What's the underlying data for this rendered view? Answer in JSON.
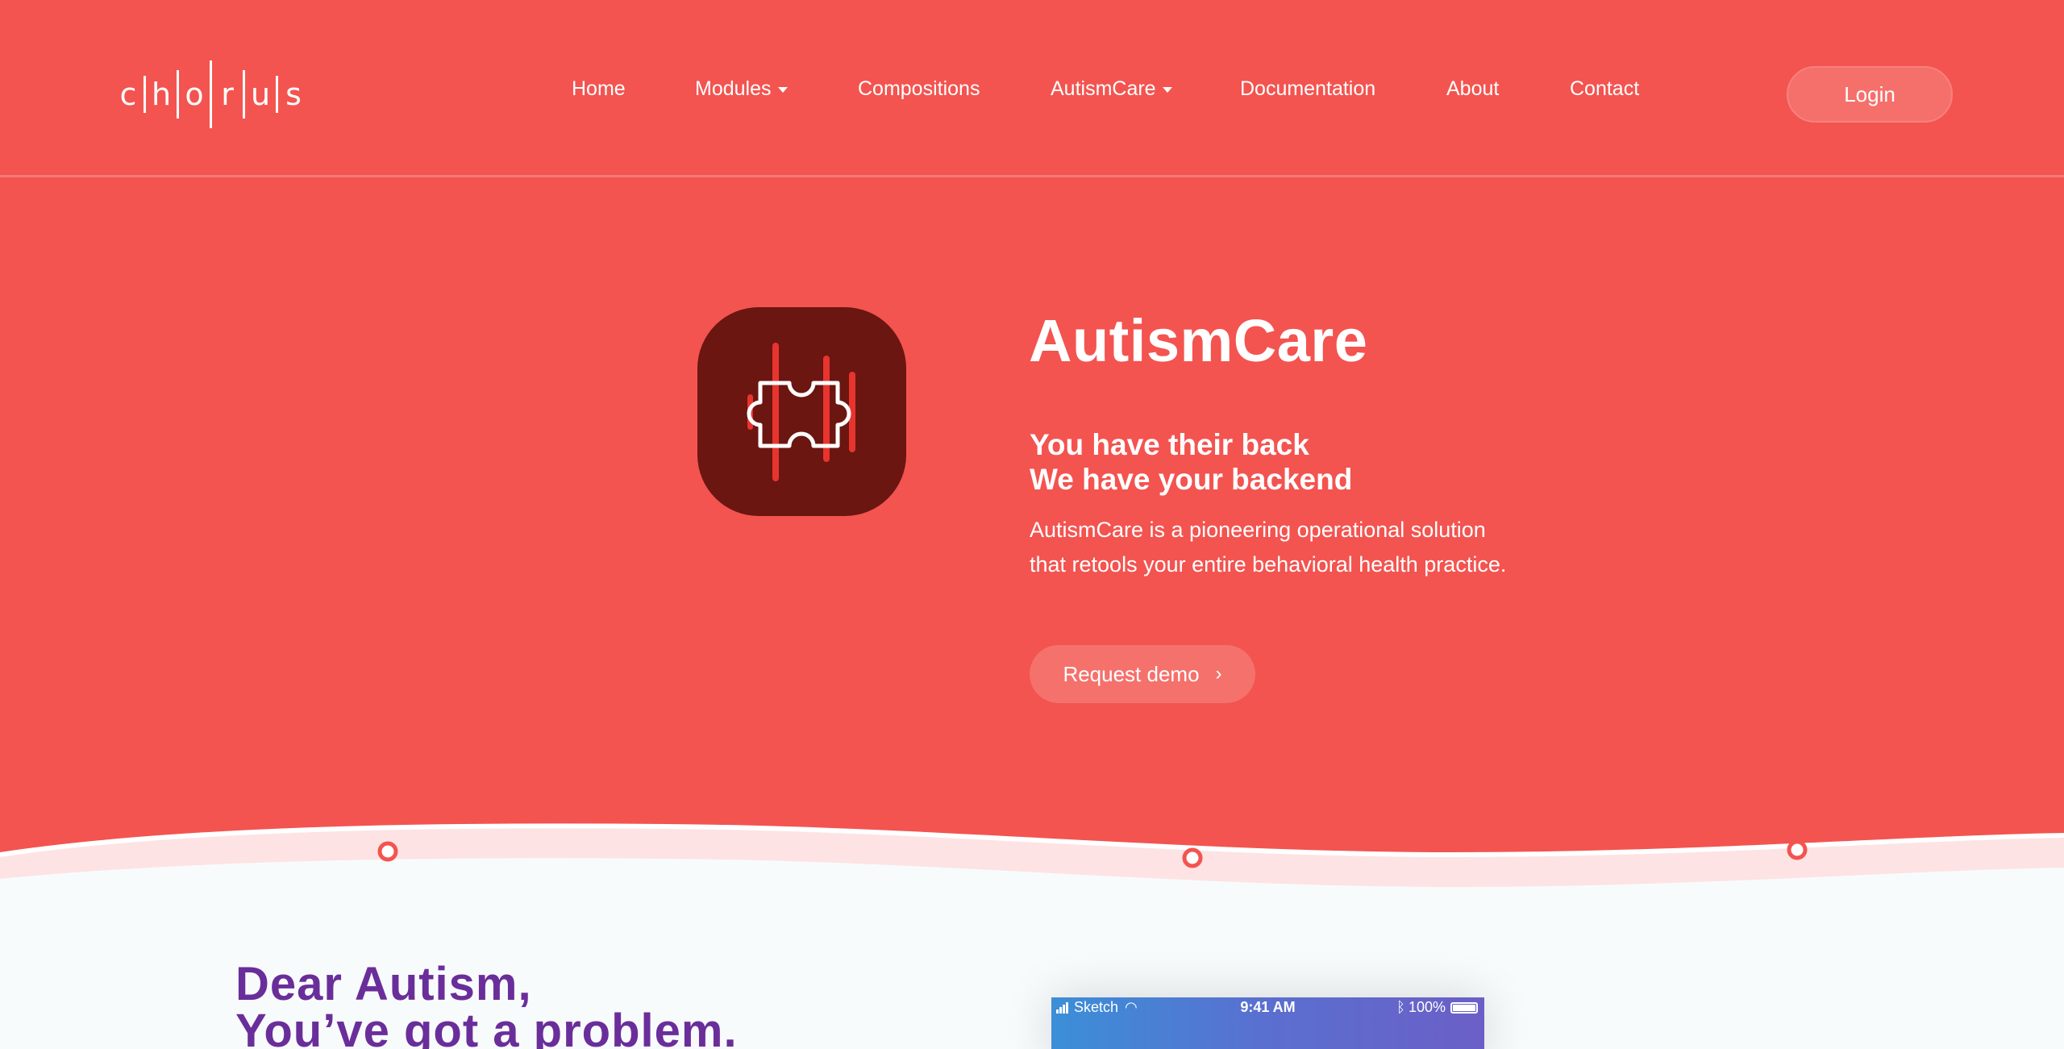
{
  "brand": {
    "letters": [
      "c",
      "h",
      "o",
      "r",
      "u",
      "s"
    ]
  },
  "nav": {
    "items": [
      {
        "label": "Home",
        "dropdown": false
      },
      {
        "label": "Modules",
        "dropdown": true
      },
      {
        "label": "Compositions",
        "dropdown": false
      },
      {
        "label": "AutismCare",
        "dropdown": true
      },
      {
        "label": "Documentation",
        "dropdown": false
      },
      {
        "label": "About",
        "dropdown": false
      },
      {
        "label": "Contact",
        "dropdown": false
      }
    ],
    "login_label": "Login"
  },
  "hero": {
    "icon": "puzzle-piece-icon",
    "title": "AutismCare",
    "subtitle_line1": "You have their back",
    "subtitle_line2": "We have your backend",
    "desc_line1": "AutismCare is a pioneering operational solution",
    "desc_line2": "that retools your entire behavioral health practice.",
    "cta_label": "Request demo",
    "cta_icon": "chevron-right-icon"
  },
  "section2": {
    "heading_line1": "Dear Autism,",
    "heading_line2": "You’ve got a problem."
  },
  "phone_status": {
    "carrier": "Sketch",
    "time": "9:41 AM",
    "battery": "100%"
  },
  "colors": {
    "hero_bg": "#f35450",
    "icon_bg": "#6b1611",
    "heading_purple": "#6a2e9a",
    "button_bg": "#f5716c"
  }
}
